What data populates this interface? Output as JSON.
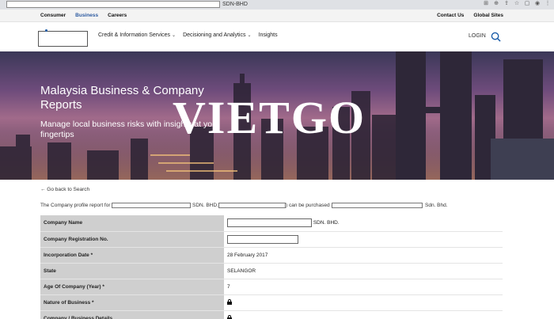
{
  "browser": {
    "url_suffix": "SDN-BHD"
  },
  "utility": {
    "left": [
      "Consumer",
      "Business",
      "Careers"
    ],
    "right": [
      "Contact Us",
      "Global Sites"
    ]
  },
  "nav": {
    "items": [
      "Credit & Information Services",
      "Decisioning and Analytics",
      "Insights"
    ],
    "login": "LOGIN"
  },
  "hero": {
    "title": "Malaysia Business & Company Reports",
    "subtitle": "Manage local business risks with insights at your fingertips",
    "watermark": "VIETGO"
  },
  "back_link": "← Go back to Search",
  "intro": {
    "p1": "The Company profile report for",
    "p2": "SDN. BHD. (",
    "p3": ") can be purchased at",
    "p4": "Sdn. Bhd."
  },
  "profile": {
    "company_name_label": "Company Name",
    "company_name_suffix": "SDN. BHD.",
    "reg_no_label": "Company Registration No.",
    "inc_date_label": "Incorporation Date *",
    "inc_date_value": "28 February 2017",
    "state_label": "State",
    "state_value": "SELANGOR",
    "age_label": "Age Of Company (Year) *",
    "age_value": "7",
    "nature_label": "Nature of Business *",
    "details_label": "Company / Business Details"
  },
  "colors": {
    "accent": "#2c5aa0",
    "label_bg": "#cfcfcf"
  }
}
